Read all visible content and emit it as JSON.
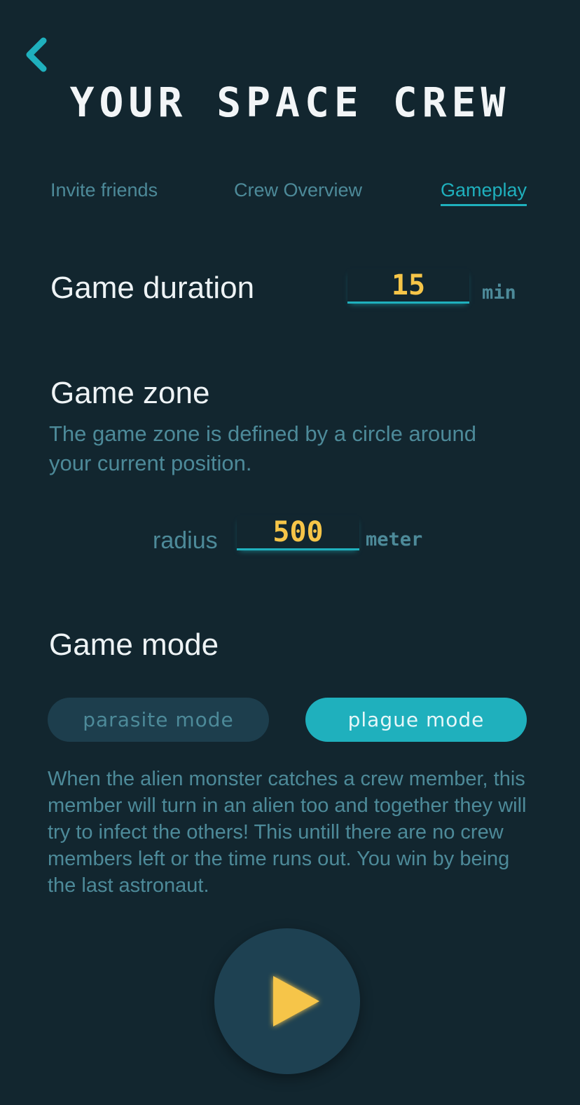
{
  "header": {
    "title": "YOUR SPACE CREW",
    "back_icon": "chevron-left-icon"
  },
  "tabs": [
    {
      "label": "Invite friends",
      "active": false
    },
    {
      "label": "Crew Overview",
      "active": false
    },
    {
      "label": "Gameplay",
      "active": true
    }
  ],
  "duration": {
    "title": "Game duration",
    "value": "15",
    "unit": "min"
  },
  "zone": {
    "title": "Game zone",
    "description": "The game zone is defined by a circle around your current position.",
    "radius_label": "radius",
    "radius_value": "500",
    "radius_unit": "meter"
  },
  "mode": {
    "title": "Game mode",
    "options": [
      {
        "label": "parasite mode",
        "selected": false
      },
      {
        "label": "plague mode",
        "selected": true
      }
    ],
    "description": "When the alien monster catches a crew member, this member will turn in an alien too and together they will try to infect the others! This untill there are no crew members left or the time runs out. You win by being the last astronaut."
  },
  "play_button": {
    "icon": "play-icon"
  },
  "colors": {
    "background": "#12262f",
    "accent": "#1fb0bd",
    "highlight": "#f6c548",
    "muted_text": "#4d8a99",
    "surface": "#1e4152"
  }
}
